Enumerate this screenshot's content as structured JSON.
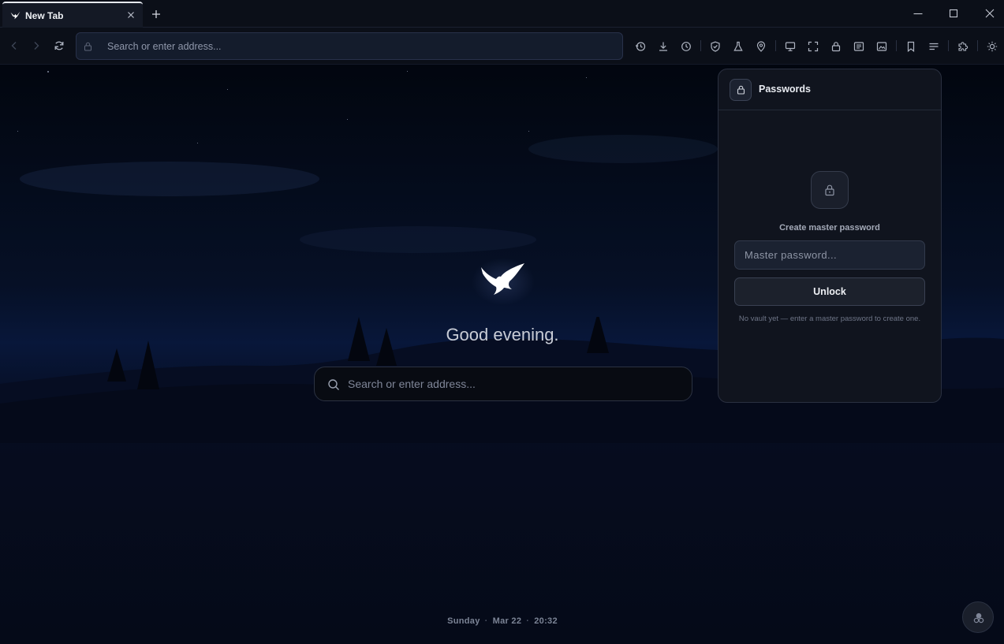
{
  "tab": {
    "title": "New Tab"
  },
  "nav": {
    "address_placeholder": "Search or enter address..."
  },
  "toolbar": {
    "icons": [
      "history-icon",
      "download-icon",
      "clock-icon",
      "shield-icon",
      "flask-icon",
      "location-pin-icon",
      "monitor-icon",
      "fullscreen-icon",
      "lock-icon",
      "reader-icon",
      "image-icon",
      "bookmark-icon",
      "menu-lines-icon",
      "puzzle-icon",
      "sun-icon"
    ]
  },
  "newtab": {
    "greeting": "Good evening.",
    "search_placeholder": "Search or enter address...",
    "date": {
      "day": "Sunday",
      "date": "Mar 22",
      "time": "20:32"
    }
  },
  "passwords": {
    "title": "Passwords",
    "label": "Create master password",
    "input_placeholder": "Master password...",
    "unlock_label": "Unlock",
    "note": "No vault yet — enter a master password to create one."
  },
  "colors": {
    "background": "#050a16",
    "panel": "#10141e",
    "accent": "#e6e9f0"
  }
}
